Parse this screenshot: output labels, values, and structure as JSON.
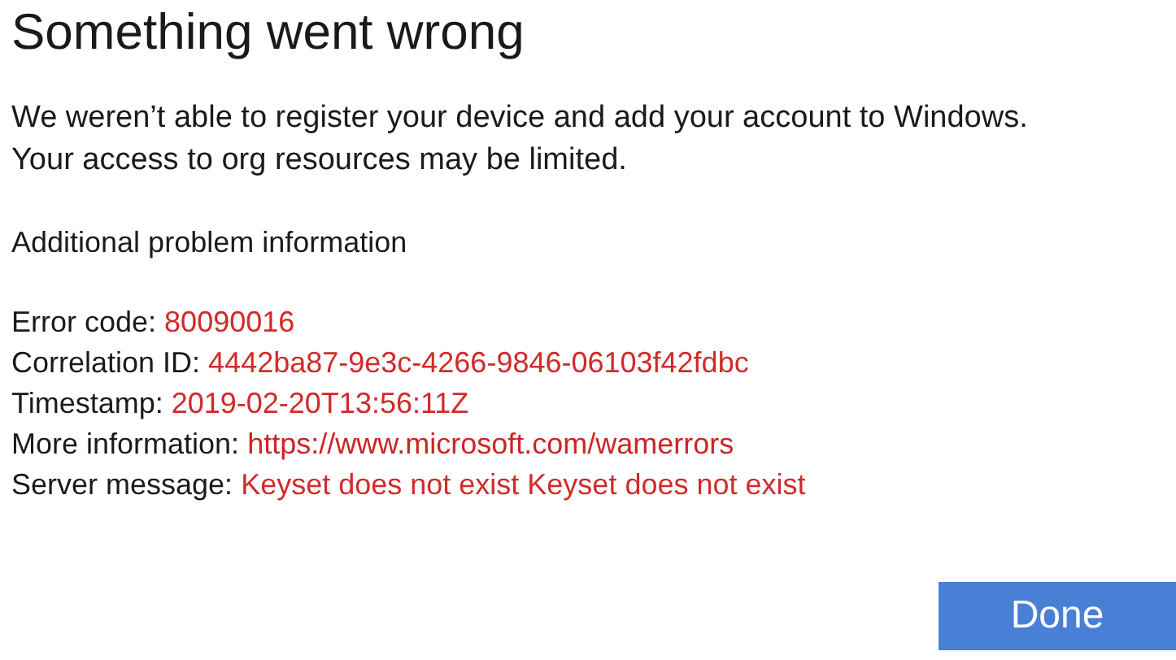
{
  "title": "Something went wrong",
  "message": "We weren’t able to register your device and add your account to Windows. Your access to org resources may be limited.",
  "section_heading": "Additional problem information",
  "details": [
    {
      "label": "Error code:",
      "value": "80090016",
      "kind": "text"
    },
    {
      "label": "Correlation ID:",
      "value": "4442ba87-9e3c-4266-9846-06103f42fdbc",
      "kind": "text"
    },
    {
      "label": "Timestamp:",
      "value": "2019-02-20T13:56:11Z",
      "kind": "text"
    },
    {
      "label": "More information:",
      "value": "https://www.microsoft.com/wamerrors",
      "kind": "link"
    },
    {
      "label": "Server message:",
      "value": "Keyset does not exist Keyset does not exist",
      "kind": "text"
    }
  ],
  "button": "Done"
}
